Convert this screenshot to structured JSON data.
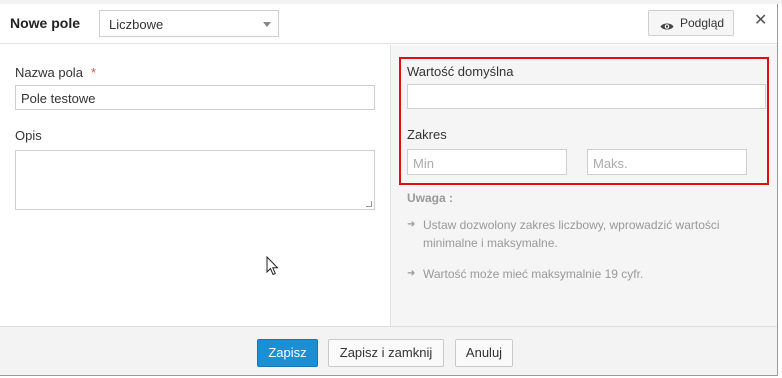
{
  "dialog": {
    "title": "Nowe pole",
    "field_type": {
      "selected": "Liczbowe"
    },
    "preview_label": "Podgląd",
    "close_glyph": "✕"
  },
  "left": {
    "name_label": "Nazwa pola",
    "required_mark": "*",
    "name_value": "Pole testowe",
    "desc_label": "Opis",
    "desc_value": ""
  },
  "right": {
    "default_label": "Wartość domyślna",
    "default_value": "",
    "range_label": "Zakres",
    "min_placeholder": "Min",
    "max_placeholder": "Maks.",
    "note_title": "Uwaga :",
    "notes": [
      "Ustaw dozwolony zakres liczbowy, wprowadzić wartości minimalne i maksymalne.",
      "Wartość może mieć maksymalnie 19 cyfr."
    ]
  },
  "footer": {
    "save_label": "Zapisz",
    "save_close_label": "Zapisz i zamknij",
    "cancel_label": "Anuluj"
  },
  "colors": {
    "primary": "#1a8fd4",
    "highlight": "#e01010",
    "required": "#e04b4b"
  },
  "icons": [
    "eye-icon",
    "close-icon",
    "chevron-down-icon",
    "arrow-right-icon",
    "mouse-cursor-icon"
  ]
}
